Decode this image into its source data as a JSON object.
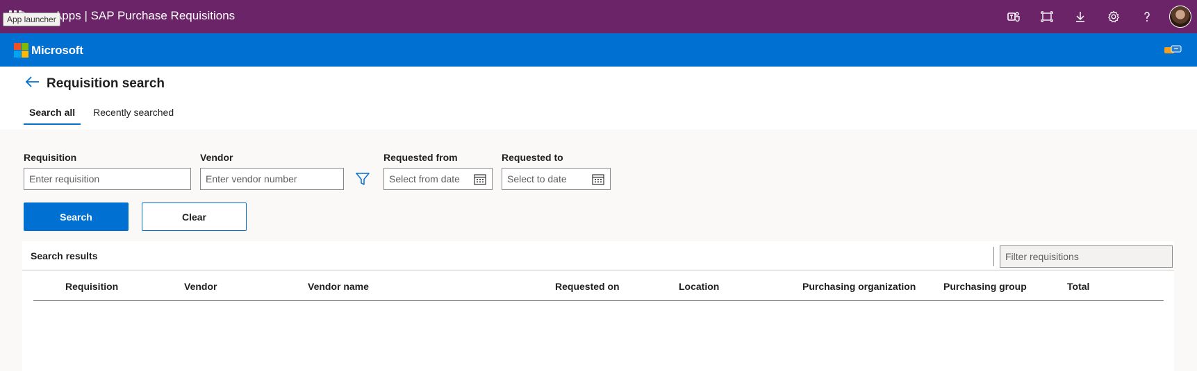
{
  "suite_bar": {
    "app_title": "Power Apps  |  SAP Purchase Requisitions",
    "tooltip": "App launcher",
    "icons": [
      "teams-icon",
      "fit-screen-icon",
      "download-icon",
      "settings-icon",
      "help-icon",
      "avatar"
    ]
  },
  "brand_bar": {
    "logo_text": "Microsoft",
    "logo_colors": [
      "#f25022",
      "#7fba00",
      "#00a4ef",
      "#ffb900"
    ]
  },
  "header": {
    "title": "Requisition search",
    "tabs": [
      {
        "label": "Search all",
        "active": true
      },
      {
        "label": "Recently searched",
        "active": false
      }
    ]
  },
  "form": {
    "requisition": {
      "label": "Requisition",
      "placeholder": "Enter requisition",
      "value": ""
    },
    "vendor": {
      "label": "Vendor",
      "placeholder": "Enter vendor number",
      "value": ""
    },
    "requested_from": {
      "label": "Requested from",
      "placeholder": "Select from date",
      "value": ""
    },
    "requested_to": {
      "label": "Requested to",
      "placeholder": "Select to date",
      "value": ""
    },
    "search_label": "Search",
    "clear_label": "Clear"
  },
  "results": {
    "title": "Search results",
    "filter_placeholder": "Filter requisitions",
    "columns": [
      "Requisition",
      "Vendor",
      "Vendor name",
      "Requested on",
      "Location",
      "Purchasing organization",
      "Purchasing group",
      "Total"
    ],
    "rows": []
  },
  "colors": {
    "suite_bar": "#6b2468",
    "brand_bar": "#0070d2",
    "accent": "#0070d2"
  }
}
